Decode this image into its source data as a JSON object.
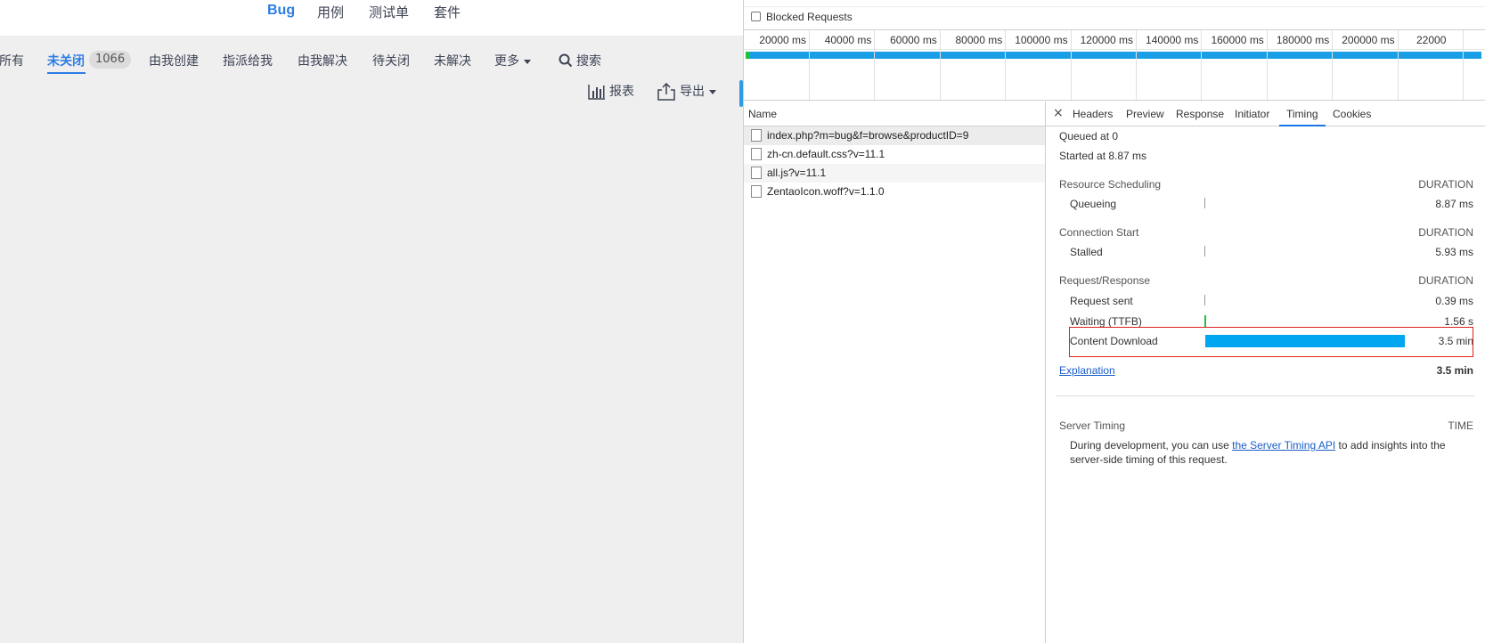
{
  "app": {
    "nav": [
      {
        "label": "Bug",
        "active": true
      },
      {
        "label": "用例",
        "active": false
      },
      {
        "label": "测试单",
        "active": false
      },
      {
        "label": "套件",
        "active": false
      }
    ],
    "filters": [
      {
        "label": "所有"
      },
      {
        "label": "未关闭",
        "active": true,
        "count": "1066"
      },
      {
        "label": "由我创建"
      },
      {
        "label": "指派给我"
      },
      {
        "label": "由我解决"
      },
      {
        "label": "待关闭"
      },
      {
        "label": "未解决"
      },
      {
        "label": "更多"
      },
      {
        "label": "搜索"
      }
    ],
    "toolbar": {
      "report_label": "报表",
      "export_label": "导出"
    }
  },
  "devtools": {
    "blocked_requests_label": "Blocked Requests",
    "overview_ticks": [
      "20000 ms",
      "40000 ms",
      "60000 ms",
      "80000 ms",
      "100000 ms",
      "120000 ms",
      "140000 ms",
      "160000 ms",
      "180000 ms",
      "200000 ms",
      "22000"
    ],
    "name_header": "Name",
    "requests": [
      "index.php?m=bug&f=browse&productID=9",
      "zh-cn.default.css?v=11.1",
      "all.js?v=11.1",
      "ZentaoIcon.woff?v=1.1.0"
    ],
    "tabs": [
      "Headers",
      "Preview",
      "Response",
      "Initiator",
      "Timing",
      "Cookies"
    ],
    "active_tab": "Timing",
    "timing": {
      "queued_at": "Queued at 0",
      "started_at": "Started at 8.87 ms",
      "sections": [
        {
          "title": "Resource Scheduling",
          "right": "DURATION",
          "rows": [
            {
              "label": "Queueing",
              "value": "8.87 ms"
            }
          ]
        },
        {
          "title": "Connection Start",
          "right": "DURATION",
          "rows": [
            {
              "label": "Stalled",
              "value": "5.93 ms"
            }
          ]
        },
        {
          "title": "Request/Response",
          "right": "DURATION",
          "rows": [
            {
              "label": "Request sent",
              "value": "0.39 ms"
            },
            {
              "label": "Waiting (TTFB)",
              "value": "1.56 s"
            },
            {
              "label": "Content Download",
              "value": "3.5 min"
            }
          ]
        }
      ],
      "explanation_link": "Explanation",
      "total": "3.5 min",
      "server_timing": {
        "title": "Server Timing",
        "right": "TIME",
        "text_before": "During development, you can use ",
        "link": "the Server Timing API",
        "text_after": " to add insights into the",
        "text_line2": "server-side timing of this request."
      }
    },
    "colors": {
      "download_bar": "#00a6f0",
      "ttfb_bar": "#1ec23c",
      "overview_bar": "#1a9fe6",
      "highlight": "#e02020"
    }
  }
}
